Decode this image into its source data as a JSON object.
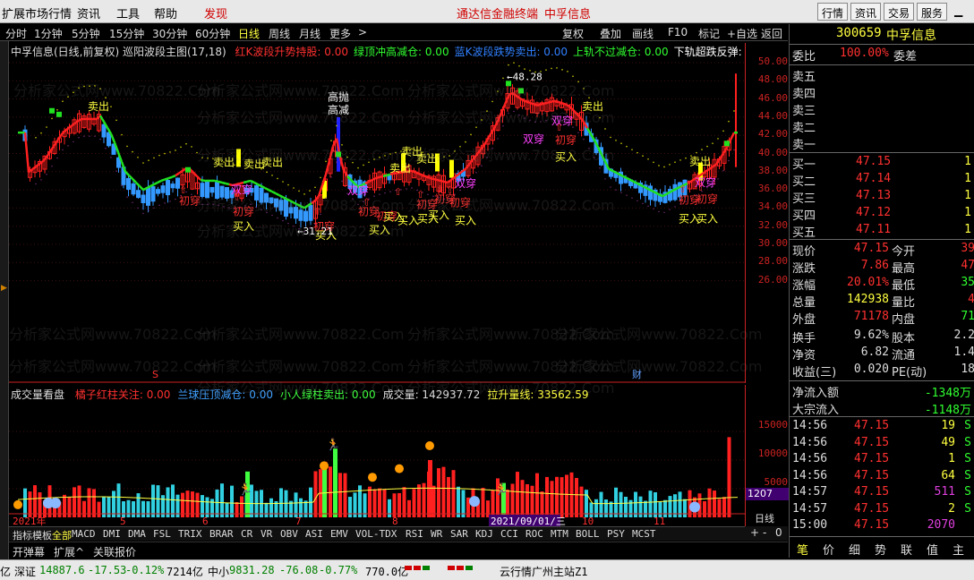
{
  "menu": {
    "items": [
      "扩展市场行情",
      "资讯",
      "工具",
      "帮助"
    ],
    "discover": "发现",
    "center_links": [
      "通达信金融终端",
      "中孚信息"
    ],
    "right_buttons": [
      "行情",
      "资讯",
      "交易",
      "服务"
    ]
  },
  "periods": {
    "items": [
      "分时",
      "1分钟",
      "5分钟",
      "15分钟",
      "30分钟",
      "60分钟",
      "日线",
      "周线",
      "月线",
      "更多",
      ">"
    ],
    "active": "日线",
    "tools": [
      "复权",
      "叠加",
      "画线",
      "F10",
      "标记",
      "+自选",
      "返回"
    ]
  },
  "main_header": {
    "title": "中孚信息(日线,前复权) 巡阳波段主图(17,18)",
    "items": [
      {
        "label": "红K波段升势持股: 0.00",
        "color": "#ff3030"
      },
      {
        "label": "绿顶冲高减仓: 0.00",
        "color": "#30ff30"
      },
      {
        "label": "蓝K波段跌势卖出: 0.00",
        "color": "#3080ff"
      },
      {
        "label": "上轨不过减仓: 0.00",
        "color": "#30ff30"
      },
      {
        "label": "下轨超跌反弹: (",
        "color": "#ffffff"
      }
    ],
    "colors": {
      "up": "#ff2020",
      "down": "#3399ff",
      "ma_up": "#ff2020",
      "ma_down": "#20e020",
      "yellow": "#ffff00"
    }
  },
  "price_axis": [
    "50.00",
    "48.00",
    "46.00",
    "44.00",
    "42.00",
    "40.00",
    "38.00",
    "36.00",
    "34.00",
    "32.00",
    "30.00",
    "28.00",
    "26.00"
  ],
  "price_labels": {
    "high": "48.28",
    "low": "31.21"
  },
  "signals": {
    "sell": "卖出",
    "buy": "买入",
    "first": "初穿",
    "double": "双穿",
    "top": "高抛",
    "reduce": "高减"
  },
  "markers": {
    "s_mark": "S",
    "cai": "财"
  },
  "vol_header": {
    "title": "成交量看盘",
    "items": [
      {
        "label": "橘子红柱关注: 0.00",
        "color": "#ff3030"
      },
      {
        "label": "兰球压顶减仓: 0.00",
        "color": "#40a0ff"
      },
      {
        "label": "小人绿柱卖出: 0.00",
        "color": "#40ff40"
      },
      {
        "label": "成交量: 142937.72",
        "color": "#dddddd"
      },
      {
        "label": "拉升量线: 33562.59",
        "color": "#ffff40"
      }
    ]
  },
  "vol_axis": [
    "15000",
    "10000",
    "5000"
  ],
  "vol_current": "1207",
  "date_axis": [
    "2021年",
    "5",
    "6",
    "7",
    "8",
    "2021/09/01/三",
    "10",
    "11"
  ],
  "chart_controls": {
    "period": "日线",
    "plus": "+",
    "minus": "-",
    "zero": "0"
  },
  "indicator_tabs": [
    "指标",
    "模板",
    "全部",
    "MACD",
    "DMI",
    "DMA",
    "FSL",
    "TRIX",
    "BRAR",
    "CR",
    "VR",
    "OBV",
    "ASI",
    "EMV",
    "VOL-TDX",
    "RSI",
    "WR",
    "SAR",
    "KDJ",
    "CCI",
    "ROC",
    "MTM",
    "BOLL",
    "PSY",
    "MCST"
  ],
  "sub_tabs": [
    "开弹幕",
    "扩展^",
    "关联报价"
  ],
  "stock": {
    "code": "300659",
    "name": "中孚信息"
  },
  "quote": {
    "weibi": {
      "label": "委比",
      "value": "100.00%",
      "label2": "委差"
    },
    "sells": [
      {
        "label": "卖五"
      },
      {
        "label": "卖四"
      },
      {
        "label": "卖三"
      },
      {
        "label": "卖二"
      },
      {
        "label": "卖一"
      }
    ],
    "buys": [
      {
        "label": "买一",
        "price": "47.15",
        "vol": "1"
      },
      {
        "label": "买二",
        "price": "47.14",
        "vol": "1"
      },
      {
        "label": "买三",
        "price": "47.13",
        "vol": "1"
      },
      {
        "label": "买四",
        "price": "47.12",
        "vol": "1"
      },
      {
        "label": "买五",
        "price": "47.11",
        "vol": "1"
      }
    ],
    "stats": [
      {
        "l1": "现价",
        "v1": "47.15",
        "c1": "#ff3030",
        "l2": "今开",
        "v2": "39",
        "c2": "#ff3030"
      },
      {
        "l1": "涨跌",
        "v1": "7.86",
        "c1": "#ff3030",
        "l2": "最高",
        "v2": "47",
        "c2": "#ff3030"
      },
      {
        "l1": "涨幅",
        "v1": "20.01%",
        "c1": "#ff3030",
        "l2": "最低",
        "v2": "35",
        "c2": "#30ff30"
      },
      {
        "l1": "总量",
        "v1": "142938",
        "c1": "#ffff40",
        "l2": "量比",
        "v2": "4",
        "c2": "#ff3030"
      },
      {
        "l1": "外盘",
        "v1": "71178",
        "c1": "#ff3030",
        "l2": "内盘",
        "v2": "71",
        "c2": "#30ff30"
      },
      {
        "l1": "换手",
        "v1": "9.62%",
        "c1": "#dddddd",
        "l2": "股本",
        "v2": "2.2",
        "c2": "#dddddd"
      },
      {
        "l1": "净资",
        "v1": "6.82",
        "c1": "#dddddd",
        "l2": "流通",
        "v2": "1.4",
        "c2": "#dddddd"
      },
      {
        "l1": "收益(三)",
        "v1": "0.020",
        "c1": "#dddddd",
        "l2": "PE(动)",
        "v2": "18",
        "c2": "#dddddd"
      }
    ],
    "flows": [
      {
        "label": "净流入额",
        "value": "-1348万"
      },
      {
        "label": "大宗流入",
        "value": "-1148万"
      }
    ],
    "ticks": [
      {
        "time": "14:56",
        "price": "47.15",
        "vol": "19",
        "dir": "S",
        "vc": "#ffff40"
      },
      {
        "time": "14:56",
        "price": "47.15",
        "vol": "49",
        "dir": "S",
        "vc": "#ffff40"
      },
      {
        "time": "14:56",
        "price": "47.15",
        "vol": "1",
        "dir": "S",
        "vc": "#ffff40"
      },
      {
        "time": "14:56",
        "price": "47.15",
        "vol": "64",
        "dir": "S",
        "vc": "#ffff40"
      },
      {
        "time": "14:57",
        "price": "47.15",
        "vol": "511",
        "dir": "S",
        "vc": "#e040e0"
      },
      {
        "time": "14:57",
        "price": "47.15",
        "vol": "2",
        "dir": "S",
        "vc": "#ffff40"
      },
      {
        "time": "15:00",
        "price": "47.15",
        "vol": "2070",
        "dir": "",
        "vc": "#e040e0"
      }
    ],
    "bottom_tabs": [
      "笔",
      "价",
      "细",
      "势",
      "联",
      "值",
      "主"
    ]
  },
  "status": {
    "items": [
      {
        "text": "亿",
        "color": "#000"
      },
      {
        "text": "深证",
        "color": "#000"
      },
      {
        "text": "14887.6",
        "color": "#008000"
      },
      {
        "text": "-17.53",
        "color": "#008000"
      },
      {
        "text": "-0.12%",
        "color": "#008000"
      },
      {
        "text": "7214亿",
        "color": "#000"
      },
      {
        "text": "中小",
        "color": "#000"
      },
      {
        "text": "9831.28",
        "color": "#008000"
      },
      {
        "text": "-76.08",
        "color": "#008000"
      },
      {
        "text": "-0.77%",
        "color": "#008000"
      },
      {
        "text": "770.0亿",
        "color": "#000"
      },
      {
        "text": "云行情广州主站Z1",
        "color": "#000"
      }
    ]
  },
  "watermark": "分析家公式网www.70822.Com"
}
